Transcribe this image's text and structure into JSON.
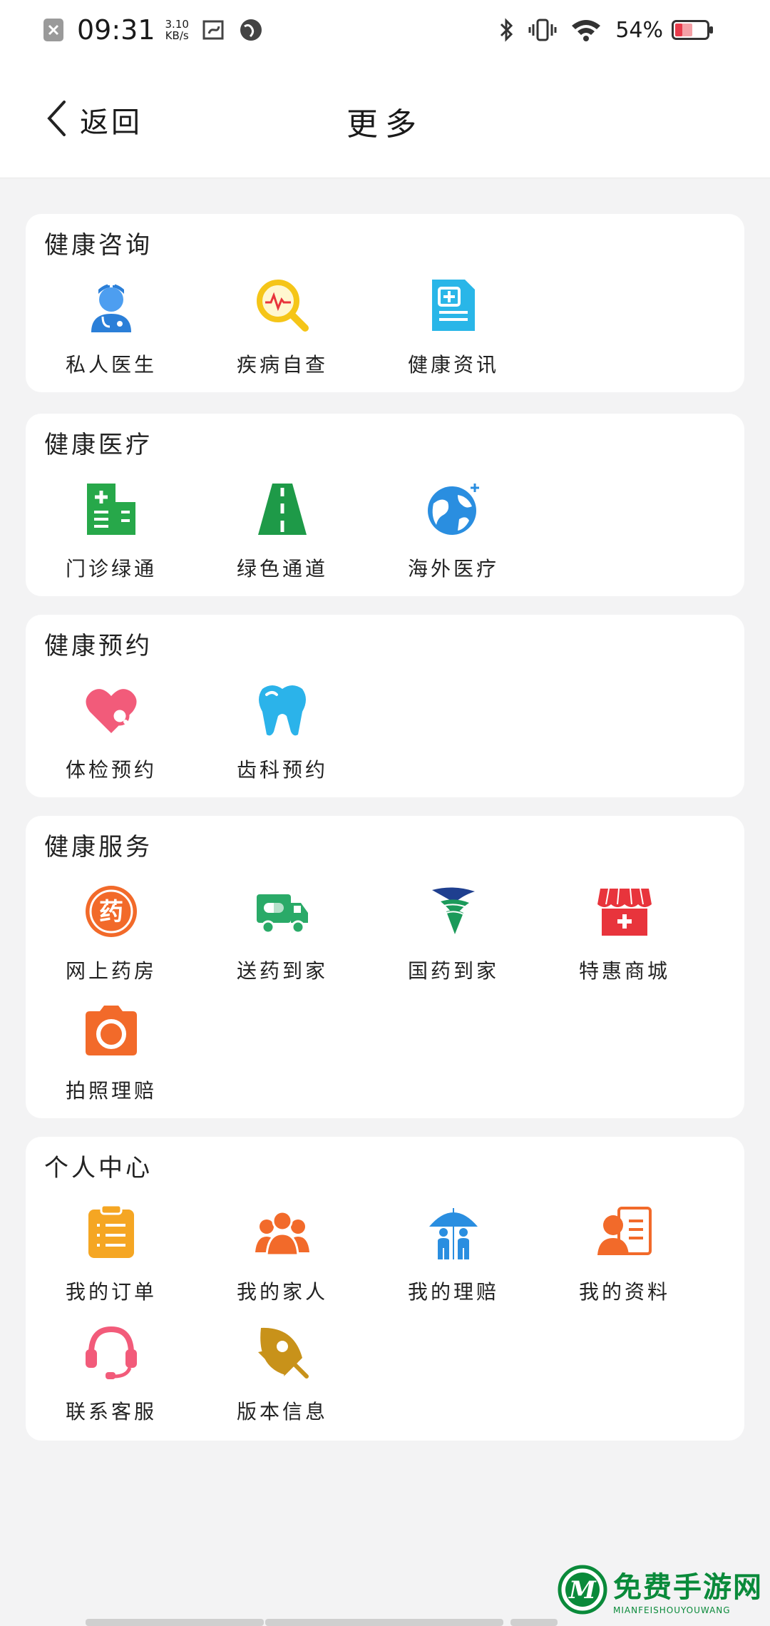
{
  "status_bar": {
    "time": "09:31",
    "net_speed_value": "3.10",
    "net_speed_unit": "KB/s",
    "battery": "54%"
  },
  "nav": {
    "back_label": "返回",
    "title": "更多"
  },
  "sections": [
    {
      "title": "健康咨询",
      "items": [
        {
          "label": "私人医生",
          "icon": "doctor-icon"
        },
        {
          "label": "疾病自查",
          "icon": "magnifier-heartbeat-icon"
        },
        {
          "label": "健康资讯",
          "icon": "health-news-doc-icon"
        }
      ]
    },
    {
      "title": "健康医疗",
      "items": [
        {
          "label": "门诊绿通",
          "icon": "hospital-icon"
        },
        {
          "label": "绿色通道",
          "icon": "road-icon"
        },
        {
          "label": "海外医疗",
          "icon": "globe-icon"
        }
      ]
    },
    {
      "title": "健康预约",
      "items": [
        {
          "label": "体检预约",
          "icon": "heart-search-icon"
        },
        {
          "label": "齿科预约",
          "icon": "tooth-icon"
        }
      ]
    },
    {
      "title": "健康服务",
      "items": [
        {
          "label": "网上药房",
          "icon": "pharmacy-icon",
          "glyph": "药"
        },
        {
          "label": "送药到家",
          "icon": "delivery-truck-icon"
        },
        {
          "label": "国药到家",
          "icon": "sinopharm-logo-icon"
        },
        {
          "label": "特惠商城",
          "icon": "shop-icon"
        },
        {
          "label": "拍照理赔",
          "icon": "camera-icon"
        }
      ]
    },
    {
      "title": "个人中心",
      "items": [
        {
          "label": "我的订单",
          "icon": "clipboard-icon"
        },
        {
          "label": "我的家人",
          "icon": "family-icon"
        },
        {
          "label": "我的理赔",
          "icon": "umbrella-family-icon"
        },
        {
          "label": "我的资料",
          "icon": "profile-card-icon"
        },
        {
          "label": "联系客服",
          "icon": "headset-icon"
        },
        {
          "label": "版本信息",
          "icon": "rocket-icon"
        }
      ]
    }
  ],
  "watermark": {
    "title": "免费手游网",
    "subtitle": "MIANFEISHOUYOUWANG",
    "logo_letter": "M"
  },
  "colors": {
    "doctor": "#2b7fd8",
    "search": "#f5c518",
    "news": "#29b6e8",
    "green": "#27a84a",
    "globe": "#2a8ee0",
    "pink": "#f25b7a",
    "tooth": "#2bb3ea",
    "orange": "#f26a2a",
    "red": "#e8343c",
    "yellow": "#f5a623",
    "gold": "#c8921a"
  }
}
